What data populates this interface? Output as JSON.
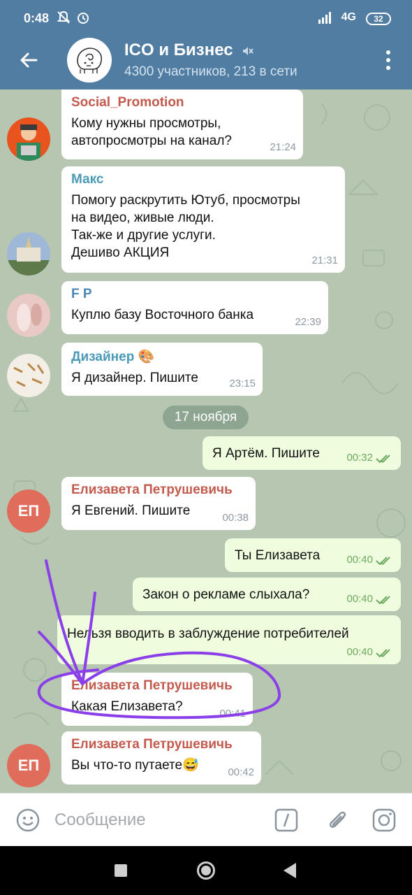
{
  "status_bar": {
    "time": "0:48",
    "network": "4G",
    "battery": "32"
  },
  "header": {
    "title": "ICO и Бизнес",
    "subtitle": "4300 участников, 213 в сети"
  },
  "messages": [
    {
      "sender": "Social_Promotion",
      "text": "Кому нужны просмотры,\nавтопросмотры на канал?",
      "time": "21:24"
    },
    {
      "sender": "Макс",
      "text": "Помогу раскрутить Ютуб, просмотры\nна видео, живые люди.\nТак-же и другие услуги.\nДешиво АКЦИЯ",
      "time": "21:31"
    },
    {
      "sender": "F P",
      "text": "Куплю базу Восточного банка",
      "time": "22:39"
    },
    {
      "sender": "Дизайнер 🎨",
      "text": "Я дизайнер. Пишите",
      "time": "23:15"
    },
    {
      "text": "Я Артём. Пишите",
      "time": "00:32"
    },
    {
      "sender": "Елизавета Петрушевичь",
      "avatar_initials": "ЕП",
      "text": "Я Евгений.  Пишите",
      "time": "00:38"
    },
    {
      "text": "Ты Елизавета",
      "time": "00:40"
    },
    {
      "text": "Закон о рекламе слыхала?",
      "time": "00:40"
    },
    {
      "text": "Нельзя вводить в заблуждение потребителей",
      "time": "00:40"
    },
    {
      "sender": "Елизавета Петрушевичь",
      "text": "Какая Елизавета?",
      "time": "00:41"
    },
    {
      "sender": "Елизавета Петрушевичь",
      "avatar_initials": "ЕП",
      "text": "Вы что-то путаете😅",
      "time": "00:42"
    }
  ],
  "date_divider": "17 ноября",
  "input": {
    "placeholder": "Сообщение"
  },
  "colors": {
    "header": "#517da2",
    "sender_red": "#c35a4e",
    "sender_teal": "#4a9ab8",
    "sender_blue": "#4a86b8",
    "outgoing_bubble": "#effdde",
    "annotation_purple": "#8a3fe8"
  },
  "icons": {
    "back": "arrow-left-icon",
    "mute": "muted-speaker-icon",
    "menu": "vertical-dots-icon",
    "emoji": "smiley-icon",
    "command": "slash-icon",
    "attach": "paperclip-icon",
    "camera": "instagram-camera-icon",
    "read": "double-check-icon"
  }
}
